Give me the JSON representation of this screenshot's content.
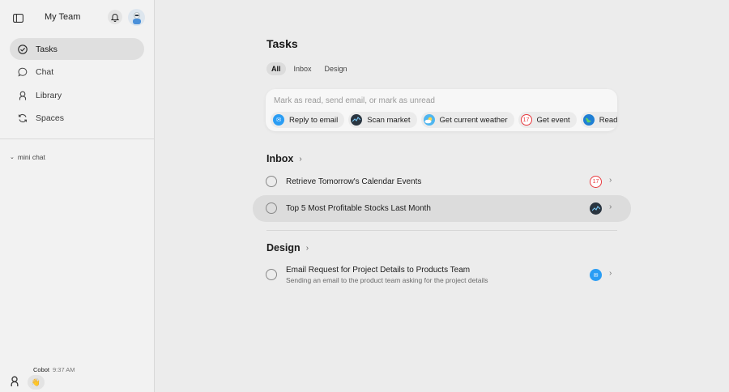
{
  "sidebar": {
    "team_name": "My Team",
    "nav": [
      {
        "label": "Tasks",
        "icon": "check-circle-icon",
        "active": true
      },
      {
        "label": "Chat",
        "icon": "chat-bubble-icon",
        "active": false
      },
      {
        "label": "Library",
        "icon": "person-icon",
        "active": false
      },
      {
        "label": "Spaces",
        "icon": "refresh-icon",
        "active": false
      }
    ],
    "mini_chat_label": "mini chat",
    "last_message": {
      "author": "Cobot",
      "time": "9:37 AM",
      "emoji": "👋"
    }
  },
  "main": {
    "title": "Tasks",
    "tabs": [
      {
        "label": "All",
        "active": true
      },
      {
        "label": "Inbox",
        "active": false
      },
      {
        "label": "Design",
        "active": false
      }
    ],
    "composer": {
      "placeholder": "Mark as read, send email, or mark as unread",
      "chips": [
        {
          "label": "Reply to email",
          "icon": "mail-icon"
        },
        {
          "label": "Scan market",
          "icon": "market-chart-icon"
        },
        {
          "label": "Get current weather",
          "icon": "weather-icon"
        },
        {
          "label": "Get event",
          "icon": "calendar-icon"
        },
        {
          "label": "Read web page",
          "icon": "globe-icon"
        }
      ]
    },
    "sections": [
      {
        "name": "Inbox",
        "items": [
          {
            "title": "Retrieve Tomorrow's Calendar Events",
            "subtitle": "",
            "icon": "calendar-icon"
          },
          {
            "title": "Top 5 Most Profitable Stocks Last Month",
            "subtitle": "",
            "icon": "market-chart-icon"
          }
        ]
      },
      {
        "name": "Design",
        "items": [
          {
            "title": "Email Request for Project Details to Products Team",
            "subtitle": "Sending an email to the product team asking for the project details",
            "icon": "mail-icon"
          }
        ]
      }
    ]
  },
  "calendar_day": "17",
  "colors": {
    "accent_mail": "#2a9df4",
    "calendar_red": "#e8383d",
    "hover_row": "#dcdcdc"
  }
}
